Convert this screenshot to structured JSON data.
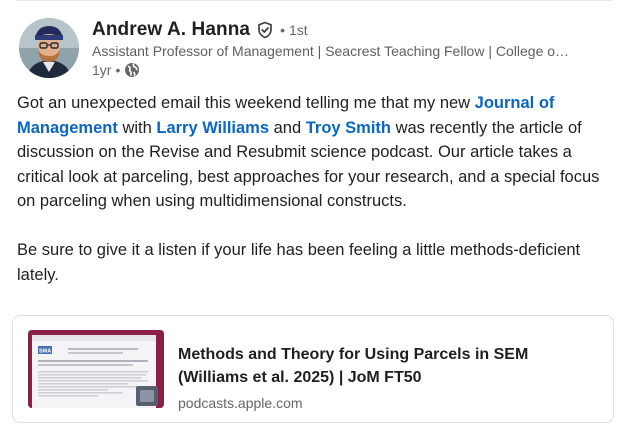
{
  "post": {
    "author": {
      "name": "Andrew A. Hanna",
      "degree_separator": "•",
      "degree": "1st",
      "headline": "Assistant Professor of Management | Seacrest Teaching Fellow | College o…",
      "time_ago": "1yr",
      "meta_separator": "•"
    },
    "body": {
      "p1_part1": "Got an unexpected email this weekend telling me that my new ",
      "mention_journal": "Journal of Management",
      "p1_part2": " with ",
      "mention_larry": "Larry Williams",
      "p1_part3": " and ",
      "mention_troy": "Troy Smith",
      "p1_part4": " was recently the article of discussion on the Revise and Resubmit science podcast. Our article takes a critical look at parceling, best approaches for your research, and a special focus on parceling when using multidimensional constructs.",
      "p2": "Be sure to give it a listen if your life has been feeling a little methods-deficient lately."
    },
    "link_card": {
      "title": "Methods and Theory for Using Parcels in SEM (Williams et al. 2025) | JoM FT50",
      "domain": "podcasts.apple.com",
      "thumb_logo": "SMA"
    }
  },
  "icons": {
    "verified": "shield-check-icon",
    "visibility": "globe-icon"
  },
  "colors": {
    "link": "#0a66c2",
    "text": "#1f1f1f",
    "muted": "#666666",
    "thumb_frame": "#8a1f48"
  }
}
